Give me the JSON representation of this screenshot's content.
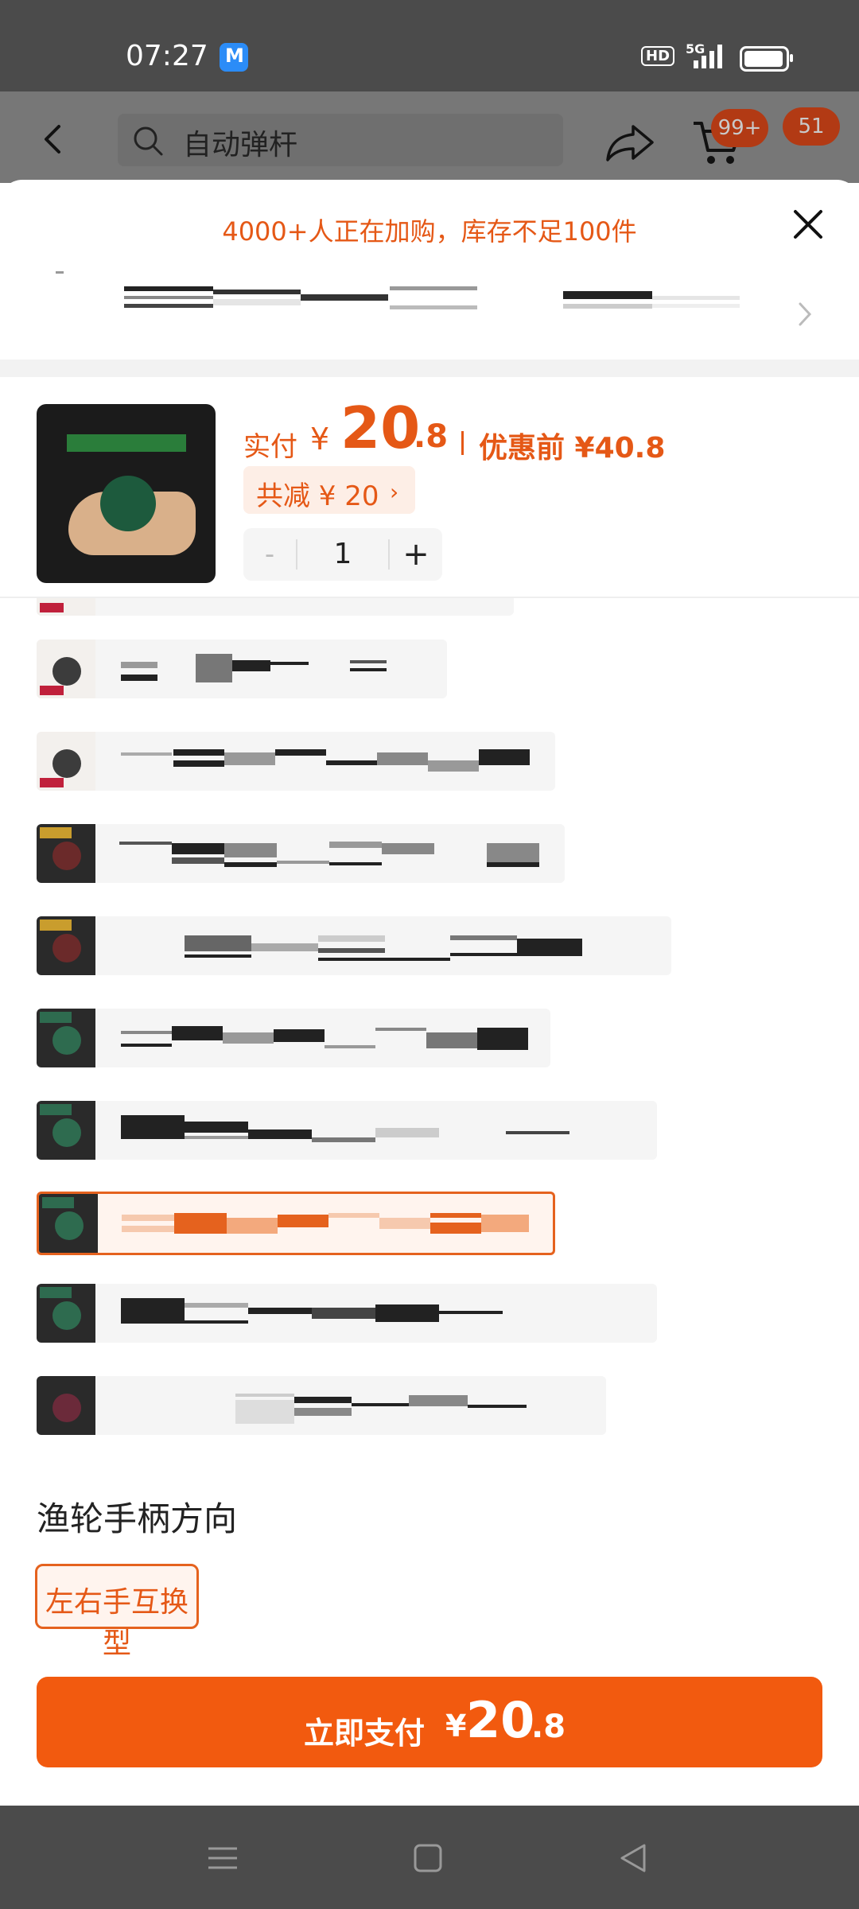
{
  "status_bar": {
    "time": "07:27",
    "hd": "HD",
    "network": "5G"
  },
  "header": {
    "search_placeholder": "自动弹杆",
    "cart_badge": "99+",
    "message_badge": "51"
  },
  "sheet": {
    "notice": "4000+人正在加购，库存不足100件",
    "price_label": "实付",
    "currency": "¥",
    "price_int": "20",
    "price_dec": ".8",
    "price_before": "优惠前 ¥40.8",
    "discount": "共减 ¥ 20",
    "quantity": "1",
    "minus": "-",
    "plus": "+",
    "handle_section_title": "渔轮手柄方向",
    "handle_option": "左右手互换型",
    "pay_label": "立即支付",
    "pay_currency": "¥",
    "pay_int": "20",
    "pay_dec": ".8"
  },
  "icons": {
    "back": "back-arrow-icon",
    "search": "search-icon",
    "share": "share-icon",
    "cart": "cart-icon",
    "close": "close-icon",
    "chevron": "chevron-right-icon",
    "nav_menu": "menu-icon",
    "nav_home": "home-icon",
    "nav_back": "nav-back-icon"
  },
  "colors": {
    "accent": "#E55816",
    "pay_button": "#F25A0F",
    "status_bar": "#4B4B4B"
  }
}
